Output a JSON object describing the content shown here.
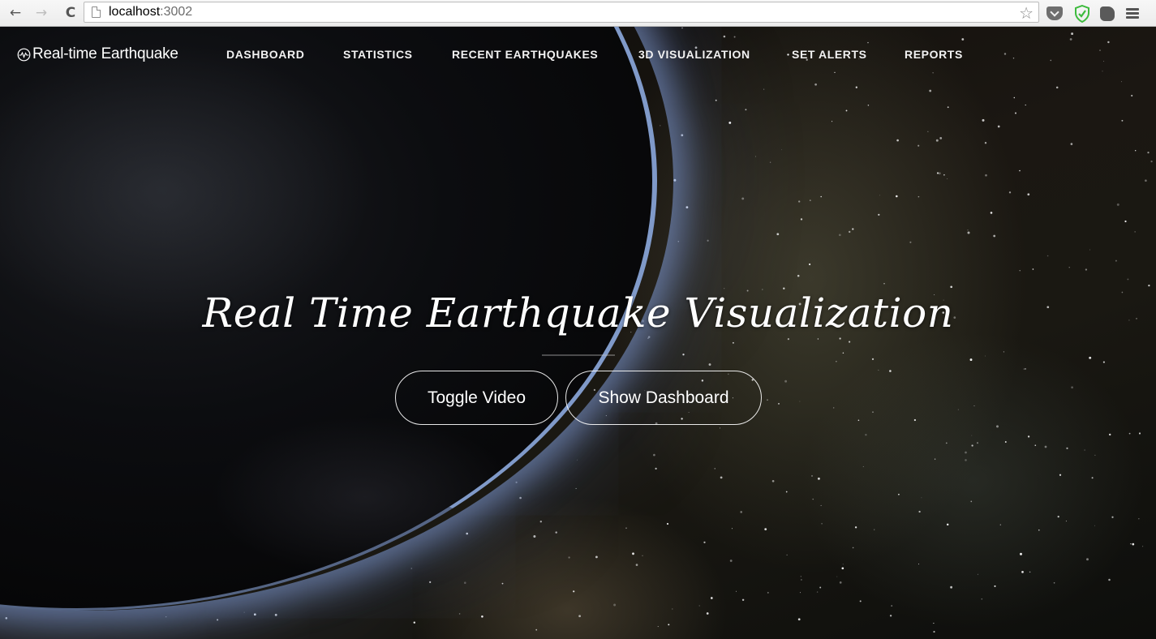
{
  "browser": {
    "url_host": "localhost",
    "url_port": ":3002",
    "back_icon": "←",
    "forward_icon": "→",
    "reload_icon": "C",
    "star_icon": "☆"
  },
  "app": {
    "brand": "Real-time Earthquake",
    "nav": [
      {
        "label": "DASHBOARD"
      },
      {
        "label": "STATISTICS"
      },
      {
        "label": "RECENT EARTHQUAKES"
      },
      {
        "label": "3D VISUALIZATION"
      },
      {
        "label": "SET ALERTS"
      },
      {
        "label": "REPORTS"
      }
    ]
  },
  "hero": {
    "title": "Real Time Earthquake Visualization",
    "buttons": {
      "toggle_video": "Toggle Video",
      "show_dashboard": "Show Dashboard"
    }
  },
  "icons": {
    "brand": "seismograph-circle-icon",
    "extension_1": "pocket-icon",
    "extension_2": "shield-check-icon",
    "extension_3": "evernote-icon",
    "menu": "hamburger-menu-icon"
  },
  "colors": {
    "shield_accent": "#3dbb3d",
    "planet_rim": "#96b4eb"
  }
}
